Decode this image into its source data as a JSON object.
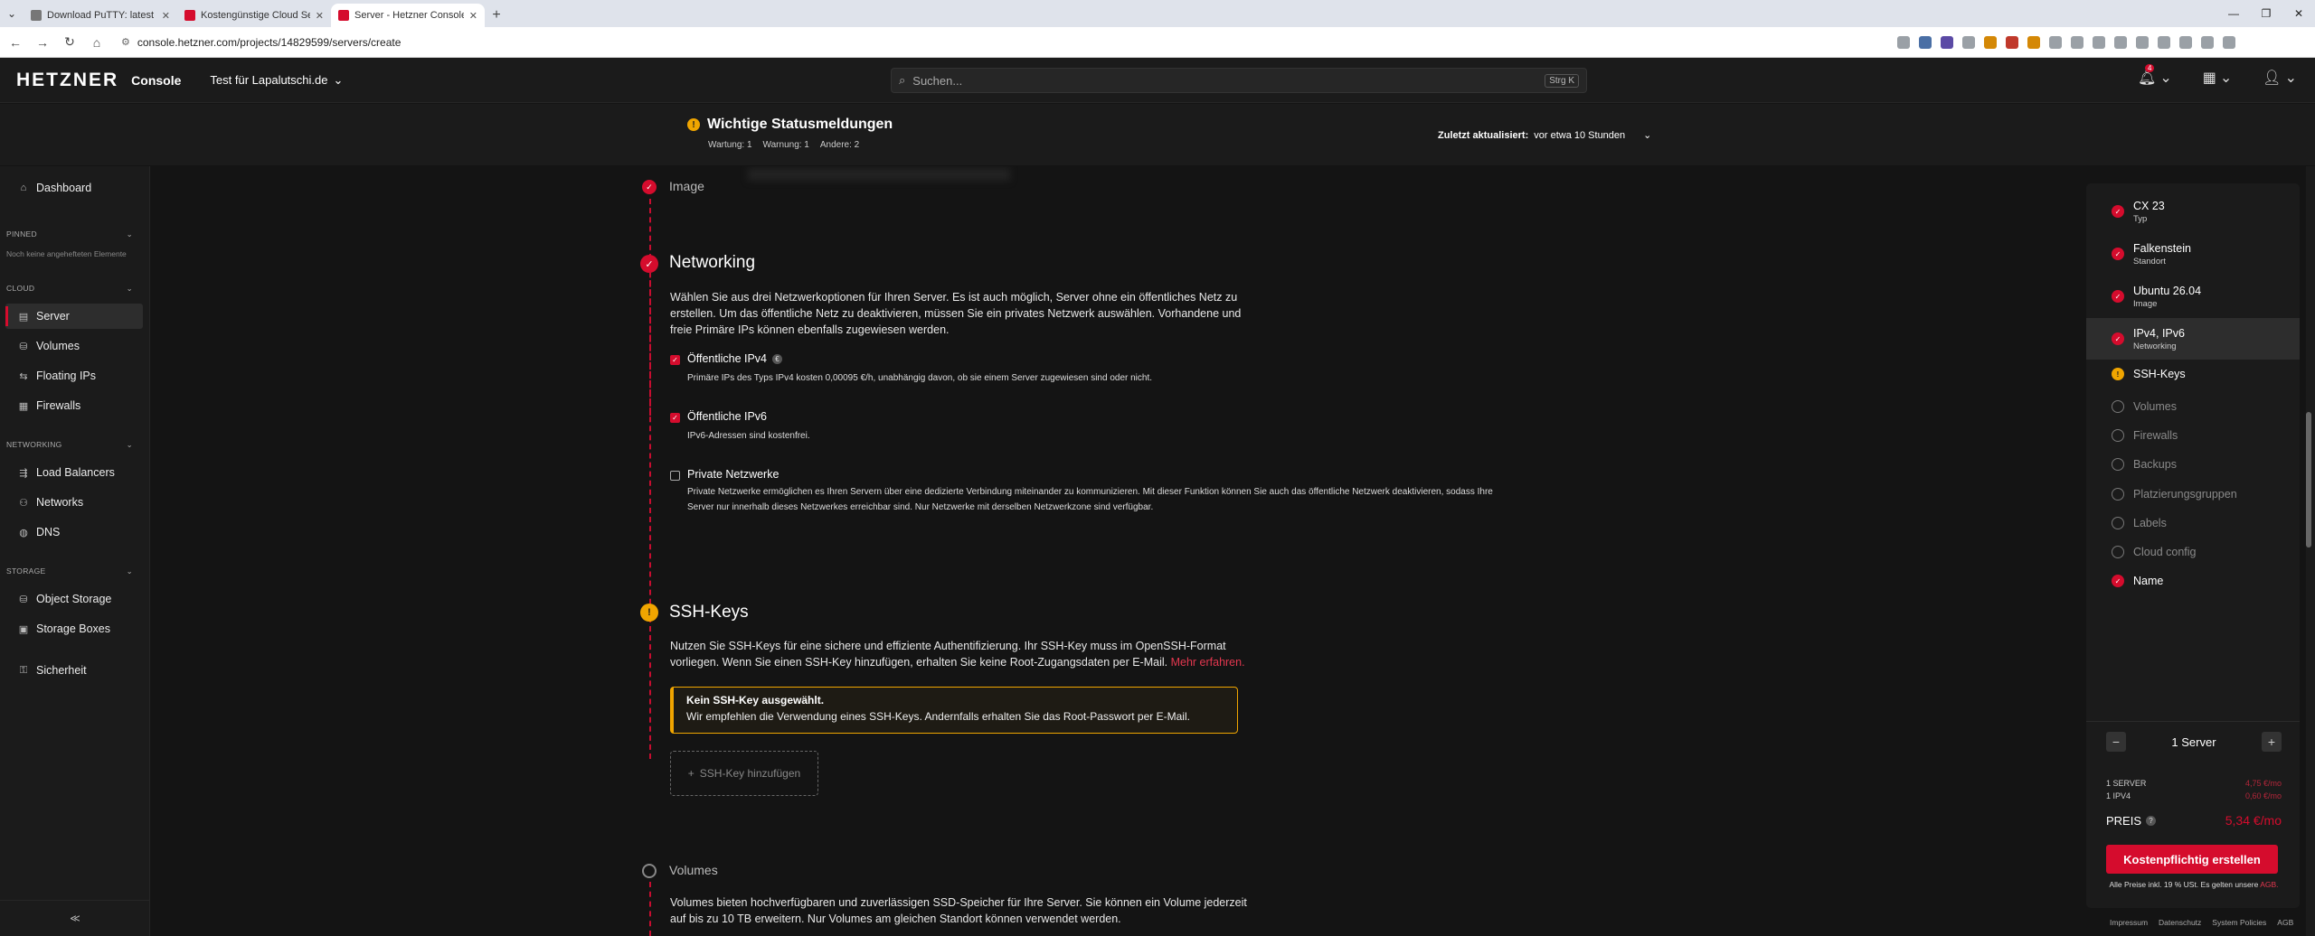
{
  "browser": {
    "tabs": [
      {
        "label": "Download PuTTY: latest release",
        "active": false
      },
      {
        "label": "Kostengünstige Cloud Server Ki",
        "active": false
      },
      {
        "label": "Server - Hetzner Console",
        "active": true
      }
    ],
    "url": "console.hetzner.com/projects/14829599/servers/create"
  },
  "header": {
    "logo": "HETZNER",
    "logo_sub": "Console",
    "project": "Test für Lapalutschi.de",
    "search_placeholder": "Suchen...",
    "search_shortcut": "Strg K",
    "notification_count": "4"
  },
  "status": {
    "title": "Wichtige Statusmeldungen",
    "counts": [
      "Wartung: 1",
      "Warnung: 1",
      "Andere: 2"
    ],
    "updated_label": "Zuletzt aktualisiert:",
    "updated_value": "vor etwa 10 Stunden"
  },
  "sidebar": {
    "dashboard": "Dashboard",
    "pinned_label": "PINNED",
    "pinned_note": "Noch keine angehefteten Elemente",
    "cloud_label": "CLOUD",
    "cloud_items": [
      "Server",
      "Volumes",
      "Floating IPs",
      "Firewalls"
    ],
    "networking_label": "NETWORKING",
    "networking_items": [
      "Load Balancers",
      "Networks",
      "DNS"
    ],
    "storage_label": "STORAGE",
    "storage_items": [
      "Object Storage",
      "Storage Boxes"
    ],
    "security": "Sicherheit"
  },
  "main": {
    "image_title": "Image",
    "networking": {
      "title": "Networking",
      "description_lines": [
        "Wählen Sie aus drei Netzwerkoptionen für Ihren Server. Es ist auch möglich, Server ohne ein öffentliches Netz zu",
        "erstellen. Um das öffentliche Netz zu deaktivieren, müssen Sie ein privates Netzwerk auswählen. Vorhandene und",
        "freie Primäre IPs können ebenfalls zugewiesen werden."
      ],
      "ipv4_label": "Öffentliche IPv4",
      "ipv4_desc": "Primäre IPs des Typs IPv4 kosten 0,00095 €/h, unabhängig davon, ob sie einem Server zugewiesen sind oder nicht.",
      "ipv6_label": "Öffentliche IPv6",
      "ipv6_desc": "IPv6-Adressen sind kostenfrei.",
      "private_label": "Private Netzwerke",
      "private_desc_lines": [
        "Private Netzwerke ermöglichen es Ihren Servern über eine dedizierte Verbindung miteinander zu kommunizieren. Mit dieser Funktion können Sie auch das öffentliche Netzwerk deaktivieren, sodass Ihre",
        "Server nur innerhalb dieses Netzwerkes erreichbar sind. Nur Netzwerke mit derselben Netzwerkzone sind verfügbar."
      ]
    },
    "ssh": {
      "title": "SSH-Keys",
      "desc_line1": "Nutzen Sie SSH-Keys für eine sichere und effiziente Authentifizierung. Ihr SSH-Key muss im OpenSSH-Format",
      "desc_line2": "vorliegen. Wenn Sie einen SSH-Key hinzufügen, erhalten Sie keine Root-Zugangsdaten per E-Mail.",
      "desc_link": "Mehr erfahren.",
      "alert_title": "Kein SSH-Key ausgewählt.",
      "alert_text": "Wir empfehlen die Verwendung eines SSH-Keys. Andernfalls erhalten Sie das Root-Passwort per E-Mail.",
      "add_button": "SSH-Key hinzufügen"
    },
    "volumes": {
      "title": "Volumes",
      "desc_line1": "Volumes bieten hochverfügbaren und zuverlässigen SSD-Speicher für Ihre Server. Sie können ein Volume jederzeit",
      "desc_line2": "auf bis zu 10 TB erweitern. Nur Volumes am gleichen Standort können verwendet werden."
    }
  },
  "summary": {
    "items": [
      {
        "main": "CX 23",
        "sub": "Typ",
        "state": "ok"
      },
      {
        "main": "Falkenstein",
        "sub": "Standort",
        "state": "ok"
      },
      {
        "main": "Ubuntu 26.04",
        "sub": "Image",
        "state": "ok"
      },
      {
        "main": "IPv4, IPv6",
        "sub": "Networking",
        "state": "ok"
      },
      {
        "main": "SSH-Keys",
        "sub": "",
        "state": "warn"
      },
      {
        "main": "Volumes",
        "sub": "",
        "state": "empty"
      },
      {
        "main": "Firewalls",
        "sub": "",
        "state": "empty"
      },
      {
        "main": "Backups",
        "sub": "",
        "state": "empty"
      },
      {
        "main": "Platzierungsgruppen",
        "sub": "",
        "state": "empty"
      },
      {
        "main": "Labels",
        "sub": "",
        "state": "empty"
      },
      {
        "main": "Cloud config",
        "sub": "",
        "state": "empty"
      },
      {
        "main": "Name",
        "sub": "",
        "state": "ok"
      }
    ],
    "quantity_label": "1 Server",
    "price_lines": [
      {
        "label": "1 SERVER",
        "value": "4,75 €/mo"
      },
      {
        "label": "1 IPV4",
        "value": "0,60 €/mo"
      }
    ],
    "price_label": "PREIS",
    "price_total": "5,34 €/mo",
    "create_button": "Kostenpflichtig erstellen",
    "vat_note": "Alle Preise inkl. 19 % USt. Es gelten unsere",
    "vat_link": "AGB."
  },
  "footer": [
    "Impressum",
    "Datenschutz",
    "System Policies",
    "AGB"
  ],
  "colors": {
    "accent": "#d50c2d",
    "warning": "#f0a500",
    "background": "#141414"
  }
}
